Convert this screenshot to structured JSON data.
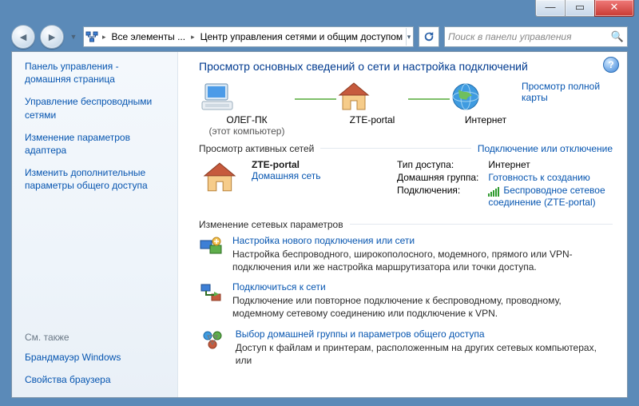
{
  "window": {
    "breadcrumb_root": "Все элементы ...",
    "breadcrumb_current": "Центр управления сетями и общим доступом",
    "search_placeholder": "Поиск в панели управления"
  },
  "sidebar": {
    "items": [
      "Панель управления - домашняя страница",
      "Управление беспроводными сетями",
      "Изменение параметров адаптера",
      "Изменить дополнительные параметры общего доступа"
    ],
    "see_also_label": "См. также",
    "see_also": [
      "Брандмауэр Windows",
      "Свойства браузера"
    ]
  },
  "main": {
    "heading": "Просмотр основных сведений о сети и настройка подключений",
    "full_map": "Просмотр полной карты",
    "nodes": {
      "pc": "ОЛЕГ-ПК",
      "pc_sub": "(этот компьютер)",
      "gateway": "ZTE-portal",
      "internet": "Интернет"
    },
    "active_label": "Просмотр активных сетей",
    "connect_link": "Подключение или отключение",
    "network": {
      "name": "ZTE-portal",
      "type_link": "Домашняя сеть"
    },
    "props": {
      "access_label": "Тип доступа:",
      "access_value": "Интернет",
      "homegroup_label": "Домашняя группа:",
      "homegroup_value": "Готовность к созданию",
      "connections_label": "Подключения:",
      "connections_value": "Беспроводное сетевое соединение (ZTE-portal)"
    },
    "settings_label": "Изменение сетевых параметров",
    "tasks": [
      {
        "title": "Настройка нового подключения или сети",
        "desc": "Настройка беспроводного, широкополосного, модемного, прямого или VPN-подключения или же настройка маршрутизатора или точки доступа."
      },
      {
        "title": "Подключиться к сети",
        "desc": "Подключение или повторное подключение к беспроводному, проводному, модемному сетевому соединению или подключение к VPN."
      },
      {
        "title": "Выбор домашней группы и параметров общего доступа",
        "desc": "Доступ к файлам и принтерам, расположенным на других сетевых компьютерах, или"
      }
    ]
  }
}
